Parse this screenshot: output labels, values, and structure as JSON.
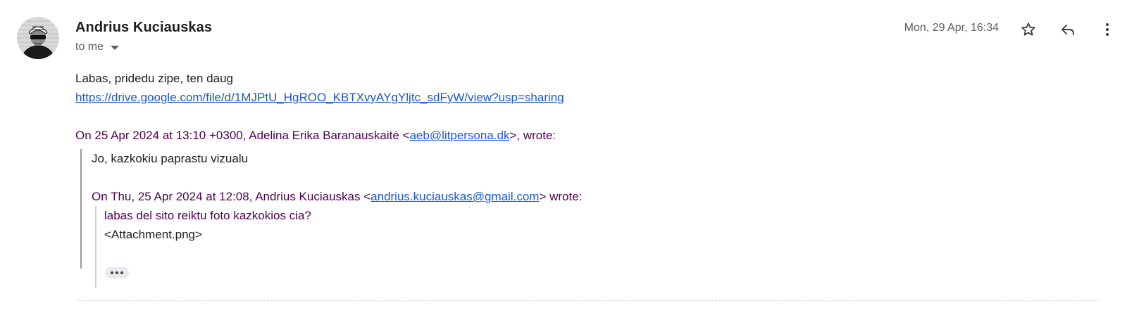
{
  "message": {
    "sender_name": "Andrius Kuciauskas",
    "recipient_label": "to me",
    "date": "Mon, 29 Apr, 16:34",
    "body_line": "Labas, pridedu zipe, ten daug",
    "link": "https://drive.google.com/file/d/1MJPtU_HgROO_KBTXvyAYgYljtc_sdFyW/view?usp=sharing",
    "quote_header_1": {
      "prefix": "On 25 Apr 2024 at 13:10 +0300, Adelina Erika Baranauskaitė <",
      "email": "aeb@litpersona.dk",
      "suffix": ">, wrote:"
    },
    "quote_1_text": "Jo, kazkokiu paprastu vizualu",
    "quote_header_2": {
      "prefix": "On Thu, 25 Apr 2024 at 12:08, Andrius Kuciauskas <",
      "email": "andrius.kuciauskas@gmail.com",
      "suffix": "> wrote:"
    },
    "quote_2_line_1": "labas del sito reiktu foto kazkokios cia?",
    "quote_2_line_2": "<Attachment.png>"
  },
  "icons": {
    "star": "star-icon",
    "reply": "reply-icon",
    "more": "more-vert-icon",
    "expand": "chevron-down-icon",
    "ellipsis": "more-horiz-icon"
  },
  "colors": {
    "link": "#1a56d6",
    "quote_header": "#500050",
    "secondary_text": "#5e5e5e"
  }
}
